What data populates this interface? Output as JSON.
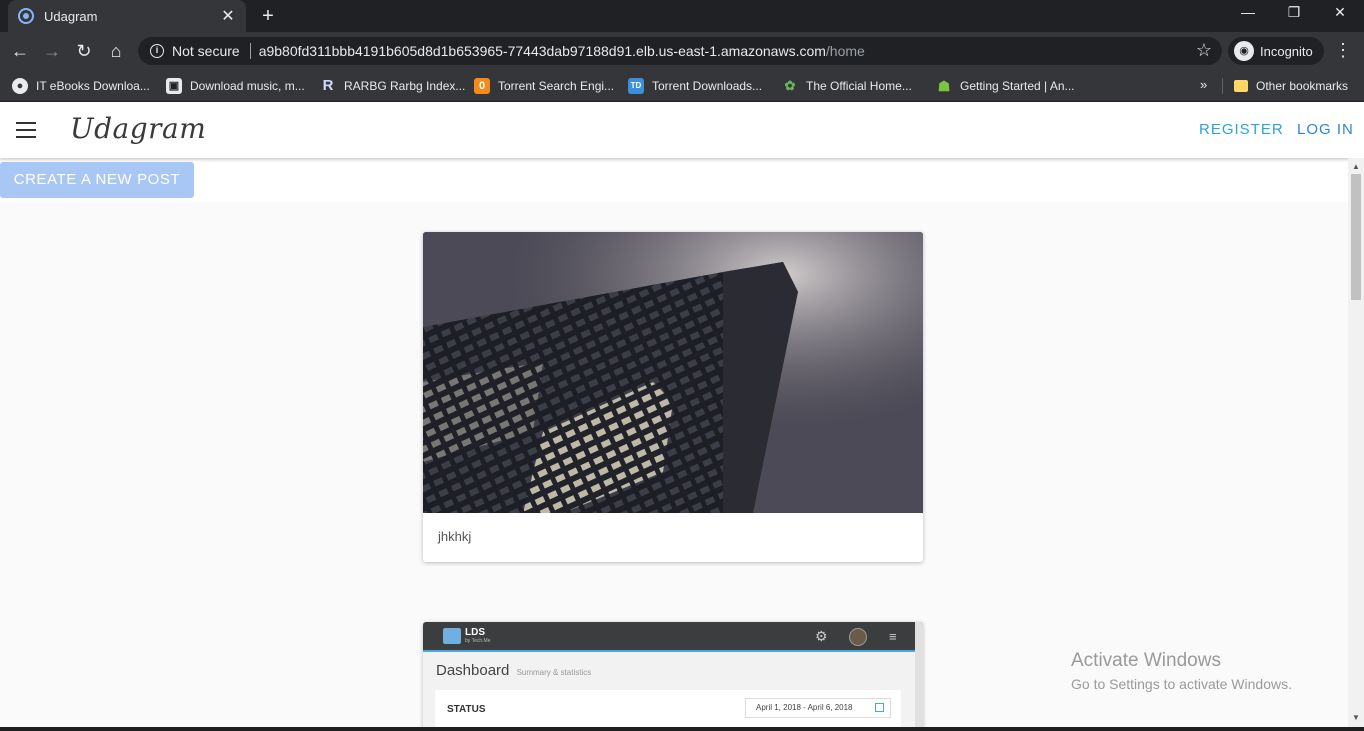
{
  "browser": {
    "tab_title": "Udagram",
    "tab_close_glyph": "✕",
    "new_tab_glyph": "+",
    "window_controls": {
      "minimize": "—",
      "restore": "❐",
      "close": "✕"
    },
    "nav": {
      "back": "←",
      "forward": "→",
      "reload": "↻",
      "home": "⌂"
    },
    "security_label": "Not secure",
    "info_glyph": "i",
    "url_host": "a9b80fd311bbb4191b605d8d1b653965-77443dab97188d91.elb.us-east-1.amazonaws.com",
    "url_path": "/home",
    "star_glyph": "☆",
    "incognito_label": "Incognito",
    "incognito_glyph": "◉",
    "menu_glyph": "⋮"
  },
  "bookmarks": {
    "items": [
      {
        "label": "IT eBooks Downloa...",
        "icon": "globe-icon",
        "glyph": "●",
        "bg": "#e8eaed",
        "fg": "#35363a"
      },
      {
        "label": "Download music, m...",
        "icon": "monitor-icon",
        "glyph": "▣",
        "bg": "#e8eaed",
        "fg": "#202124"
      },
      {
        "label": "RARBG Rarbg Index...",
        "icon": "r-logo-icon",
        "glyph": "R",
        "bg": "transparent",
        "fg": "#cfd8ff"
      },
      {
        "label": "Torrent Search Engi...",
        "icon": "torrent-icon",
        "glyph": "0",
        "bg": "#f28a1d",
        "fg": "#ffffff"
      },
      {
        "label": "Torrent Downloads...",
        "icon": "td-icon",
        "glyph": "TD",
        "bg": "#3a8fd8",
        "fg": "#ffffff"
      },
      {
        "label": "The Official Home...",
        "icon": "leaf-icon",
        "glyph": "✿",
        "bg": "transparent",
        "fg": "#6bb35a"
      },
      {
        "label": "Getting Started | An...",
        "icon": "android-icon",
        "glyph": "☗",
        "bg": "transparent",
        "fg": "#7cc243"
      }
    ],
    "more_glyph": "»",
    "other_label": "Other bookmarks"
  },
  "app": {
    "brand": "Udagram",
    "register": "REGISTER",
    "login": "LOG IN",
    "create_post": "CREATE A NEW POST"
  },
  "feed": {
    "post1": {
      "caption": "jhkhkj"
    },
    "post2": {
      "app_logo_text": "LDS",
      "app_logo_sub": "by Tech.Me",
      "gear_glyph": "⚙",
      "menu_glyph": "≡",
      "dashboard_title": "Dashboard",
      "dashboard_sub": "Summary & statistics",
      "status_label": "STATUS",
      "date_range": "April 1, 2018 - April 6, 2018"
    }
  },
  "watermark": {
    "title": "Activate Windows",
    "subtitle": "Go to Settings to activate Windows."
  },
  "scroll": {
    "up": "▲",
    "down": "▼"
  }
}
